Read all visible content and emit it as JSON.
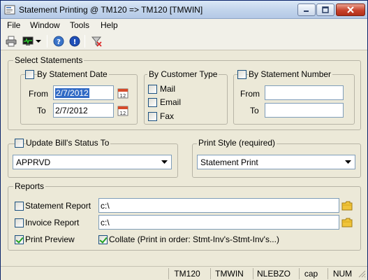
{
  "window": {
    "title": "Statement Printing @ TM120 => TM120 [TMWIN]"
  },
  "menu": {
    "items": [
      "File",
      "Window",
      "Tools",
      "Help"
    ]
  },
  "toolbar": {
    "icons": [
      "printer-icon",
      "monitor-icon",
      "dropdown-arrow-icon",
      "help-icon",
      "info-icon",
      "clear-filter-icon"
    ]
  },
  "select_statements": {
    "legend": "Select Statements",
    "by_date": {
      "label": "By Statement Date",
      "checked": false,
      "from_label": "From",
      "from_value": "2/7/2012",
      "to_label": "To",
      "to_value": "2/7/2012"
    },
    "by_customer_type": {
      "label": "By Customer Type",
      "options": [
        {
          "label": "Mail",
          "checked": false
        },
        {
          "label": "Email",
          "checked": false
        },
        {
          "label": "Fax",
          "checked": false
        }
      ]
    },
    "by_number": {
      "label": "By Statement Number",
      "checked": false,
      "from_label": "From",
      "from_value": "",
      "to_label": "To",
      "to_value": ""
    }
  },
  "update_status": {
    "label": "Update Bill's Status To",
    "checked": false,
    "selected": "APPRVD"
  },
  "print_style": {
    "label": "Print Style (required)",
    "selected": "Statement Print"
  },
  "reports": {
    "legend": "Reports",
    "statement_report": {
      "label": "Statement Report",
      "checked": false,
      "path": "c:\\"
    },
    "invoice_report": {
      "label": "Invoice Report",
      "checked": false,
      "path": "c:\\"
    },
    "print_preview": {
      "label": "Print Preview",
      "checked": true
    },
    "collate": {
      "label": "Collate (Print in order: Stmt-Inv's-Stmt-Inv's...)",
      "checked": true
    }
  },
  "statusbar": {
    "cells": [
      "TM120",
      "TMWIN",
      "NLEBZO",
      "cap",
      "NUM"
    ]
  },
  "colors": {
    "selection": "#316ac5",
    "close_button": "#c8432c",
    "check": "#21a121"
  }
}
